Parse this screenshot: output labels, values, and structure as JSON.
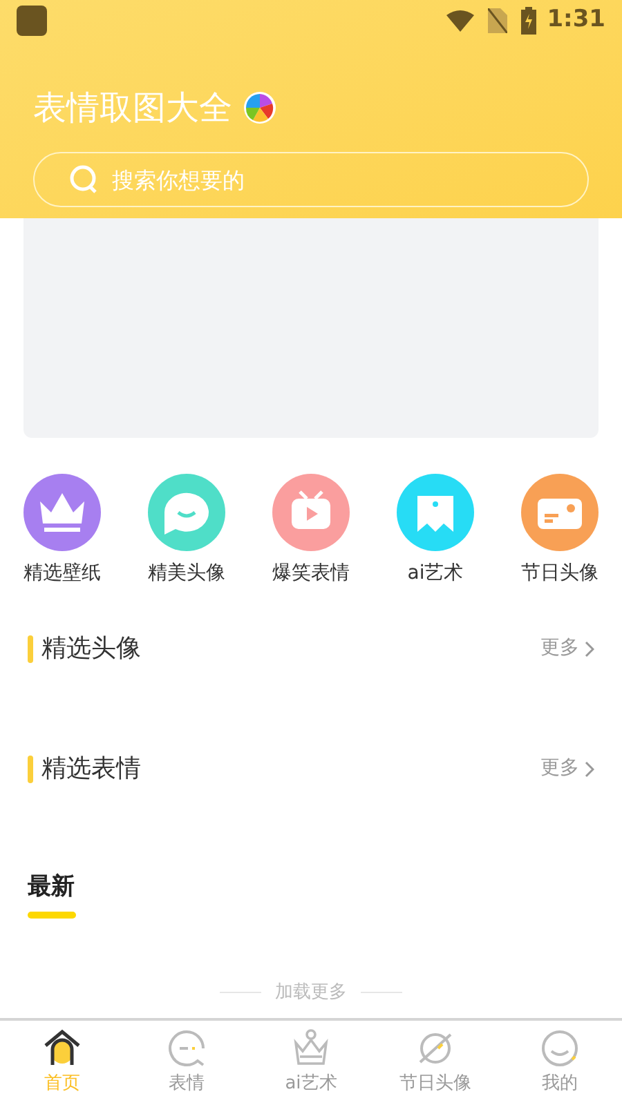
{
  "status_bar": {
    "time": "1:31"
  },
  "header": {
    "title": "表情取图大全",
    "search": {
      "placeholder": "搜索你想要的"
    }
  },
  "categories": [
    {
      "kind": "crown",
      "label": "精选壁纸",
      "color": "#a77ff0"
    },
    {
      "kind": "chat",
      "label": "精美头像",
      "color": "#4fdec8"
    },
    {
      "kind": "tv",
      "label": "爆笑表情",
      "color": "#fa9e9e"
    },
    {
      "kind": "tooth",
      "label": "ai艺术",
      "color": "#27dcf5"
    },
    {
      "kind": "card",
      "label": "节日头像",
      "color": "#f8a055"
    }
  ],
  "sections": [
    {
      "title": "精选头像",
      "more": "更多"
    },
    {
      "title": "精选表情",
      "more": "更多"
    }
  ],
  "latest": {
    "title": "最新"
  },
  "load_more": "加载更多",
  "bottom_nav": [
    {
      "kind": "home",
      "label": "首页",
      "selected": true
    },
    {
      "kind": "chat",
      "label": "表情",
      "selected": false
    },
    {
      "kind": "crown",
      "label": "ai艺术",
      "selected": false
    },
    {
      "kind": "planet",
      "label": "节日头像",
      "selected": false
    },
    {
      "kind": "smile",
      "label": "我的",
      "selected": false
    }
  ]
}
